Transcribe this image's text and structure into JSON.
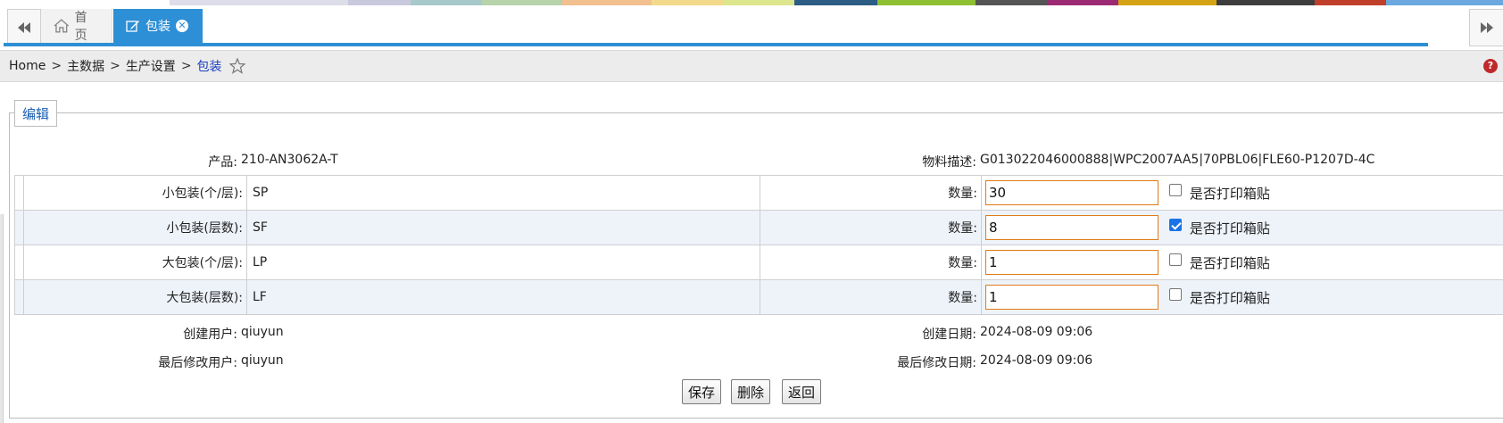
{
  "color_strip": [
    "#ffffff",
    "#dcdde8",
    "#c9c9dd",
    "#a7c9c9",
    "#b7d3a9",
    "#f2c08f",
    "#f3d98a",
    "#dde58d",
    "#2b5d85",
    "#8fbf32",
    "#555555",
    "#9c2a72",
    "#d3a313",
    "#3d3d3d",
    "#c03f2a",
    "#6aa8df"
  ],
  "tabs": {
    "home_label": "首页",
    "package_label": "包装"
  },
  "breadcrumb": {
    "home": "Home",
    "sep": ">",
    "level1": "主数据",
    "level2": "生产设置",
    "current": "包装"
  },
  "form": {
    "legend": "编辑",
    "product_label": "产品:",
    "product_value": "210-AN3062A-T",
    "material_label": "物料描述:",
    "material_value": "G013022046000888|WPC2007AA5|70PBL06|FLE60-P1207D-4C",
    "packages": [
      {
        "label": "小包装(个/层):",
        "code": "SP",
        "qty_label": "数量:",
        "qty": "30",
        "print_label": "是否打印箱贴",
        "print_checked": false
      },
      {
        "label": "小包装(层数):",
        "code": "SF",
        "qty_label": "数量:",
        "qty": "8",
        "print_label": "是否打印箱贴",
        "print_checked": true
      },
      {
        "label": "大包装(个/层):",
        "code": "LP",
        "qty_label": "数量:",
        "qty": "1",
        "print_label": "是否打印箱贴",
        "print_checked": false
      },
      {
        "label": "大包装(层数):",
        "code": "LF",
        "qty_label": "数量:",
        "qty": "1",
        "print_label": "是否打印箱贴",
        "print_checked": false
      }
    ],
    "created_user_label": "创建用户:",
    "created_user": "qiuyun",
    "created_date_label": "创建日期:",
    "created_date": "2024-08-09 09:06",
    "modified_user_label": "最后修改用户:",
    "modified_user": "qiuyun",
    "modified_date_label": "最后修改日期:",
    "modified_date": "2024-08-09 09:06"
  },
  "buttons": {
    "save": "保存",
    "delete": "删除",
    "back": "返回"
  },
  "help_icon_glyph": "?",
  "accent_color": "#2d8fd5"
}
